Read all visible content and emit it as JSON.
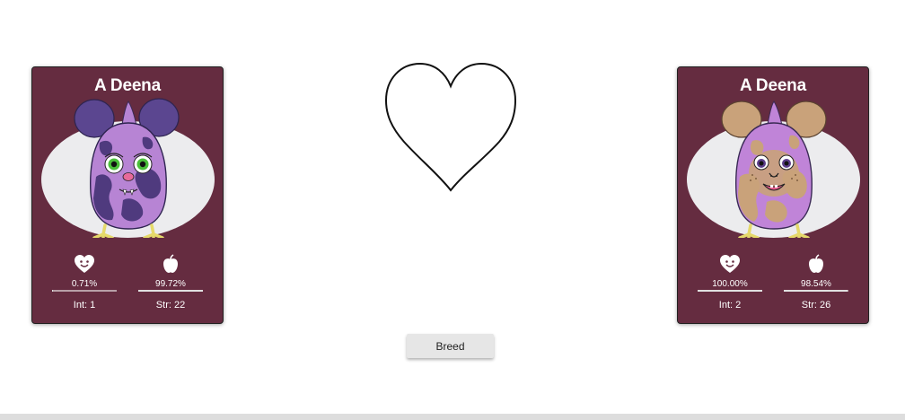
{
  "left_card": {
    "name": "A Deena",
    "happiness_pct": "0.71%",
    "happiness_fraction": 0.0071,
    "hunger_pct": "99.72%",
    "hunger_fraction": 0.9972,
    "int_label": "Int: 1",
    "str_label": "Str: 22",
    "icons": [
      "heart-face-icon",
      "apple-icon"
    ]
  },
  "right_card": {
    "name": "A Deena",
    "happiness_pct": "100.00%",
    "happiness_fraction": 1.0,
    "hunger_pct": "98.54%",
    "hunger_fraction": 0.9854,
    "int_label": "Int: 2",
    "str_label": "Str: 26",
    "icons": [
      "heart-face-icon",
      "apple-icon"
    ]
  },
  "center": {
    "icon": "heart-outline-icon",
    "breed_label": "Breed"
  },
  "colors": {
    "card_bg": "#652c40",
    "oval_bg": "#ececee",
    "button_bg": "#e6e6e6"
  }
}
